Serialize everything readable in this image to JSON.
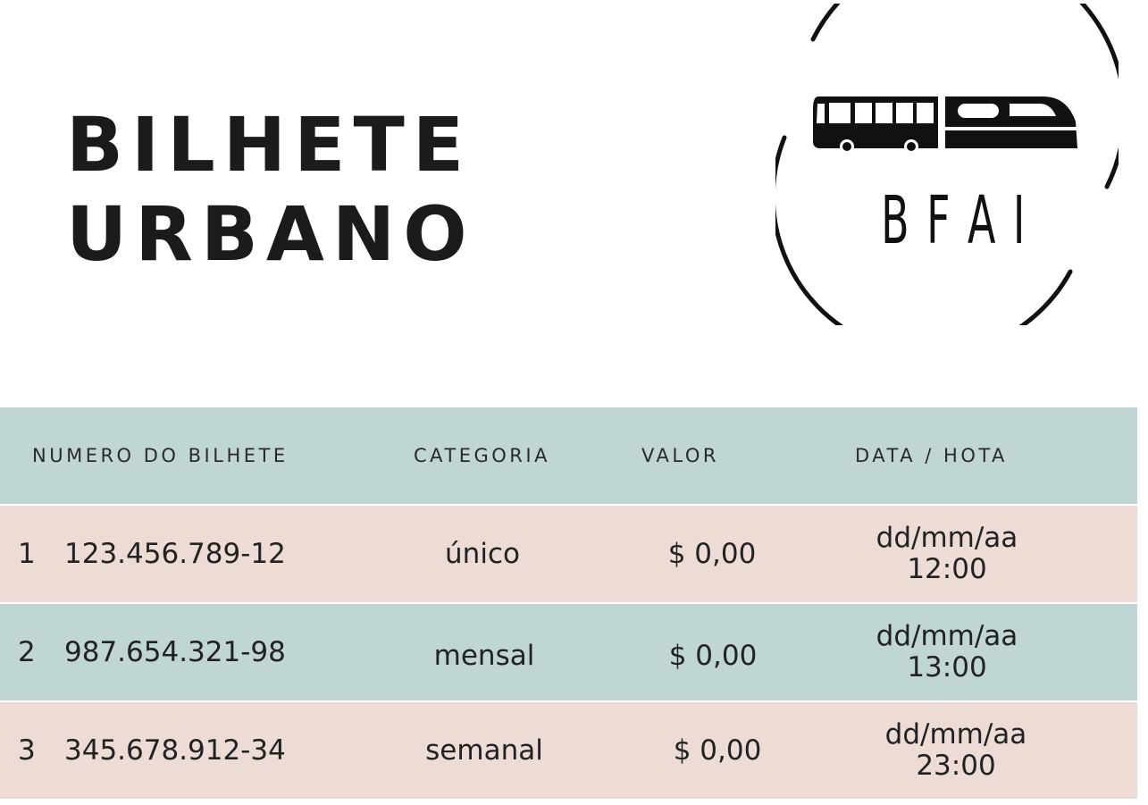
{
  "title": {
    "line1": "BILHETE",
    "line2": "URBANO"
  },
  "logo": {
    "text": "B F A I",
    "icon": "bus-train-icon",
    "color": "#111111"
  },
  "colors": {
    "header_bg": "#bfd6d4",
    "row_pink": "#eddbd6",
    "row_teal": "#bfd6d4",
    "text": "#1d1d1d"
  },
  "table": {
    "headers": [
      "NUMERO DO BILHETE",
      "CATEGORIA",
      "VALOR",
      "DATA / HOTA"
    ],
    "rows": [
      {
        "index": "1",
        "ticket": "123.456.789-12",
        "category": "único",
        "value": "$ 0,00",
        "date": "dd/mm/aa",
        "time": "12:00"
      },
      {
        "index": "2",
        "ticket": "987.654.321-98",
        "category": "mensal",
        "value": "$ 0,00",
        "date": "dd/mm/aa",
        "time": "13:00"
      },
      {
        "index": "3",
        "ticket": "345.678.912-34",
        "category": "semanal",
        "value": "$ 0,00",
        "date": "dd/mm/aa",
        "time": "23:00"
      }
    ]
  }
}
